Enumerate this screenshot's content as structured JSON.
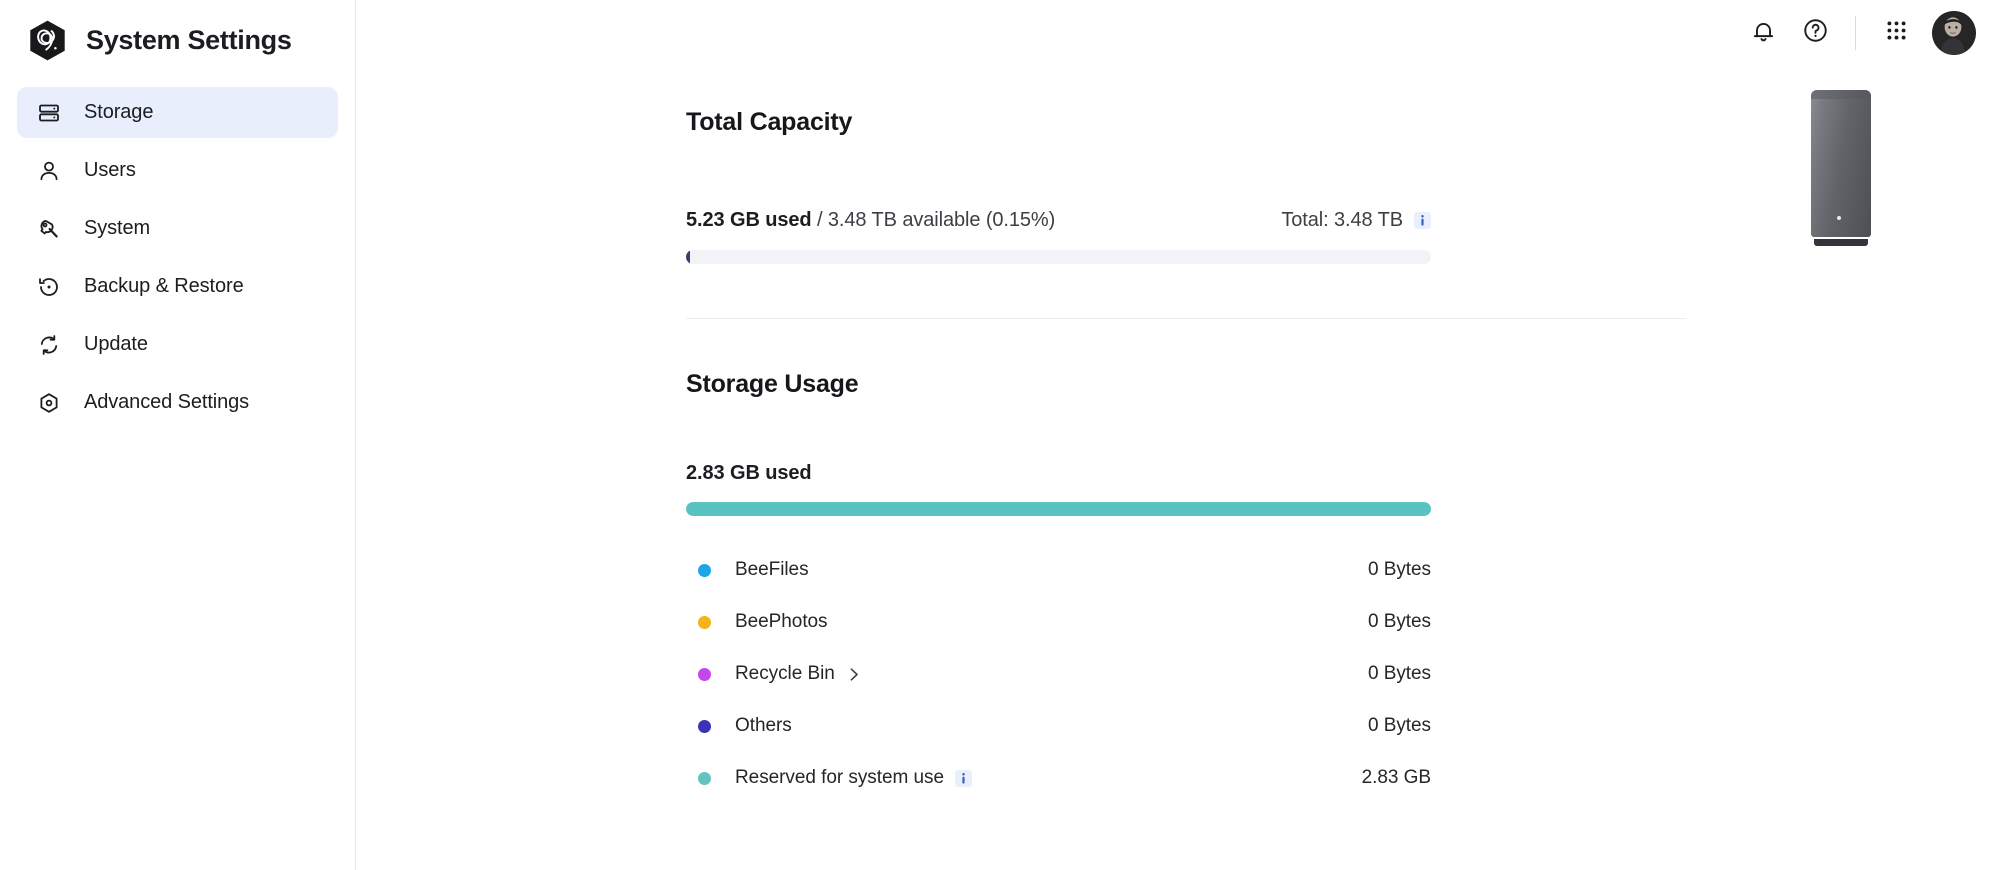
{
  "brand": {
    "title": "System Settings",
    "logo_icon": "bee-hex-logo-icon"
  },
  "sidebar": {
    "items": [
      {
        "label": "Storage",
        "icon": "server-storage-icon",
        "active": true
      },
      {
        "label": "Users",
        "icon": "user-person-icon",
        "active": false
      },
      {
        "label": "System",
        "icon": "wrench-icon",
        "active": false
      },
      {
        "label": "Backup & Restore",
        "icon": "restore-clock-icon",
        "active": false
      },
      {
        "label": "Update",
        "icon": "refresh-sync-icon",
        "active": false
      },
      {
        "label": "Advanced Settings",
        "icon": "hex-gear-icon",
        "active": false
      }
    ]
  },
  "topbar": {
    "notifications_icon": "bell-icon",
    "help_icon": "help-circle-icon",
    "apps_icon": "apps-grid-icon",
    "avatar_name": "user-avatar"
  },
  "capacity": {
    "title": "Total Capacity",
    "used_bold": "5.23 GB used",
    "used_rest": " / 3.48 TB available (0.15%)",
    "total_label": "Total: 3.48 TB",
    "info_icon": "info-icon",
    "percent_used": 0.15,
    "fill_color": "#3b3f6b",
    "track_color": "#f2f3f6",
    "device_icon": "nas-tower-device-illustration"
  },
  "usage": {
    "title": "Storage Usage",
    "used_label": "2.83 GB used",
    "bar_percent": 100,
    "bar_color": "#5bc2c2",
    "items": [
      {
        "label": "BeeFiles",
        "value": "0 Bytes",
        "color": "#1aa7e8",
        "chevron": false,
        "info": false
      },
      {
        "label": "BeePhotos",
        "value": "0 Bytes",
        "color": "#f5b318",
        "chevron": false,
        "info": false
      },
      {
        "label": "Recycle Bin",
        "value": "0 Bytes",
        "color": "#c446ec",
        "chevron": true,
        "info": false
      },
      {
        "label": "Others",
        "value": "0 Bytes",
        "color": "#3b33b5",
        "chevron": false,
        "info": false
      },
      {
        "label": "Reserved for system use",
        "value": "2.83 GB",
        "color": "#63c4bf",
        "chevron": false,
        "info": true
      }
    ]
  },
  "chart_data": {
    "type": "bar",
    "title": "Storage Usage",
    "categories": [
      "BeeFiles",
      "BeePhotos",
      "Recycle Bin",
      "Others",
      "Reserved for system use"
    ],
    "values": [
      0,
      0,
      0,
      0,
      2.83
    ],
    "value_labels": [
      "0 Bytes",
      "0 Bytes",
      "0 Bytes",
      "0 Bytes",
      "2.83 GB"
    ],
    "unit": "GB",
    "total_used_label": "2.83 GB used",
    "colors": [
      "#1aa7e8",
      "#f5b318",
      "#c446ec",
      "#3b33b5",
      "#63c4bf"
    ],
    "legend_position": "below",
    "grid": false
  }
}
